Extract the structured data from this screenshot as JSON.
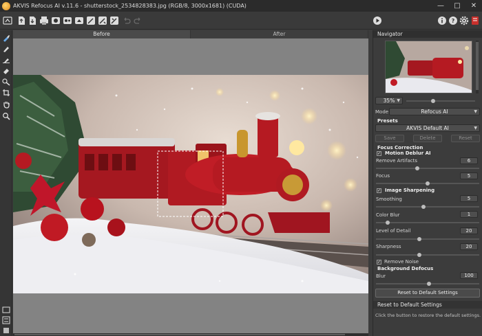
{
  "window": {
    "title": "AKVIS Refocus AI v.11.6 - shutterstock_2534828383.jpg (RGB/8, 3000x1681) (CUDA)",
    "minimize": "—",
    "maximize": "□",
    "close": "✕"
  },
  "toolbar": {
    "icons": [
      "home-icon",
      "open-file-icon",
      "save-file-icon",
      "print-icon",
      "batch-icon",
      "plugin-icon",
      "share-icon",
      "magic-wand-icon",
      "effect-icon",
      "edit-icon",
      "undo-icon",
      "redo-icon",
      "run-icon",
      "info-icon",
      "help-icon",
      "settings-icon",
      "notifications-icon"
    ]
  },
  "tabs": {
    "before": "Before",
    "after": "After"
  },
  "navigator": {
    "header": "Navigator",
    "zoom": "35%"
  },
  "mode": {
    "label": "Mode:",
    "value": "Refocus AI"
  },
  "presets": {
    "header": "Presets",
    "value": "AKVIS Default AI",
    "save": "Save",
    "delete": "Delete",
    "reset": "Reset"
  },
  "focus_correction": {
    "header": "Focus Correction",
    "motion_deblur": {
      "label": "Motion Deblur AI",
      "checked": true
    },
    "remove_artifacts": {
      "label": "Remove Artifacts",
      "value": "6",
      "fraction": 0.6
    },
    "focus": {
      "label": "Focus",
      "value": "5",
      "fraction": 0.5
    },
    "image_sharpening": {
      "label": "Image Sharpening",
      "checked": true
    },
    "smoothing": {
      "label": "Smoothing",
      "value": "5",
      "fraction": 0.5
    },
    "color_blur": {
      "label": "Color Blur",
      "value": "1",
      "fraction": 0.1
    },
    "level_of_detail": {
      "label": "Level of Detail",
      "value": "20",
      "fraction": 0.5
    },
    "sharpness": {
      "label": "Sharpness",
      "value": "20",
      "fraction": 0.5
    },
    "remove_noise": {
      "label": "Remove Noise",
      "checked": true
    }
  },
  "background_defocus": {
    "header": "Background Defocus",
    "blur": {
      "label": "Blur",
      "value": "100",
      "fraction": 0.6
    }
  },
  "reset_defaults": {
    "button": "Reset to Default Settings",
    "hint_title": "Reset to Default Settings",
    "hint_text": "Click the button to restore the default settings."
  },
  "colors": {
    "accent": "#e8a23a",
    "panel": "#3c3c3c",
    "canvas_bg": "#838383",
    "train_red": "#b01a22"
  }
}
